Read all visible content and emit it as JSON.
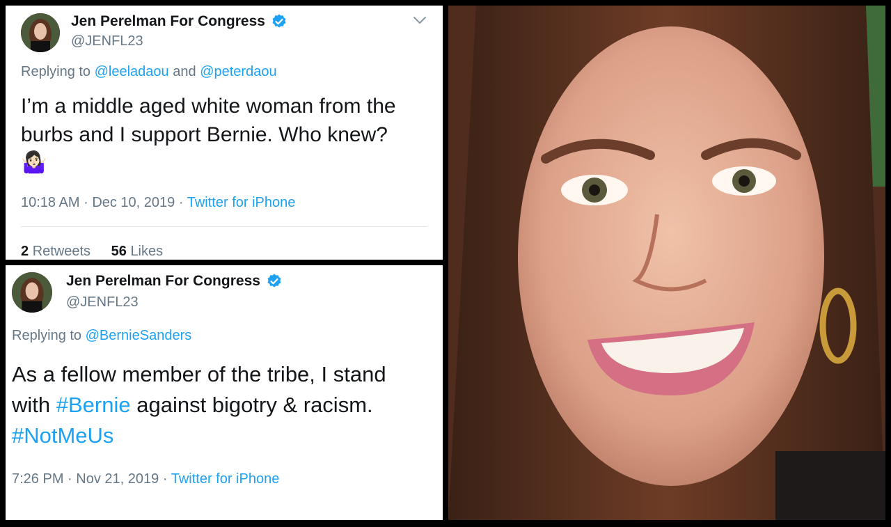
{
  "tweets": [
    {
      "name": "Jen Perelman For Congress",
      "handle": "@JENFL23",
      "replying_prefix": "Replying to",
      "replying_to": [
        "@leeladaou",
        "@peterdaou"
      ],
      "replying_join": "and",
      "text_line1": "I’m a middle aged white woman from the",
      "text_line2": "burbs and I support Bernie. Who knew?",
      "emoji": "🤷🏻‍♀️",
      "time": "10:18 AM",
      "date": "Dec 10, 2019",
      "sep": "·",
      "source": "Twitter for iPhone",
      "retweets_count": "2",
      "retweets_label": "Retweets",
      "likes_count": "56",
      "likes_label": "Likes"
    },
    {
      "name": "Jen Perelman For Congress",
      "handle": "@JENFL23",
      "replying_prefix": "Replying to",
      "replying_to": [
        "@BernieSanders"
      ],
      "text_line1": "As a fellow member of the tribe, I stand",
      "text_line2_pre": "with ",
      "hashtag1": "#Bernie",
      "text_line2_post": " against bigotry & racism.",
      "hashtag2": "#NotMeUs",
      "time": "7:26 PM",
      "date": "Nov 21, 2019",
      "sep": "·",
      "source": "Twitter for iPhone"
    }
  ],
  "colors": {
    "link": "#1da1f2",
    "secondary_text": "#657786",
    "primary_text": "#14171a",
    "background": "#000000"
  },
  "icons": [
    "verified-badge-icon",
    "chevron-down-icon",
    "shrug-emoji-icon"
  ]
}
